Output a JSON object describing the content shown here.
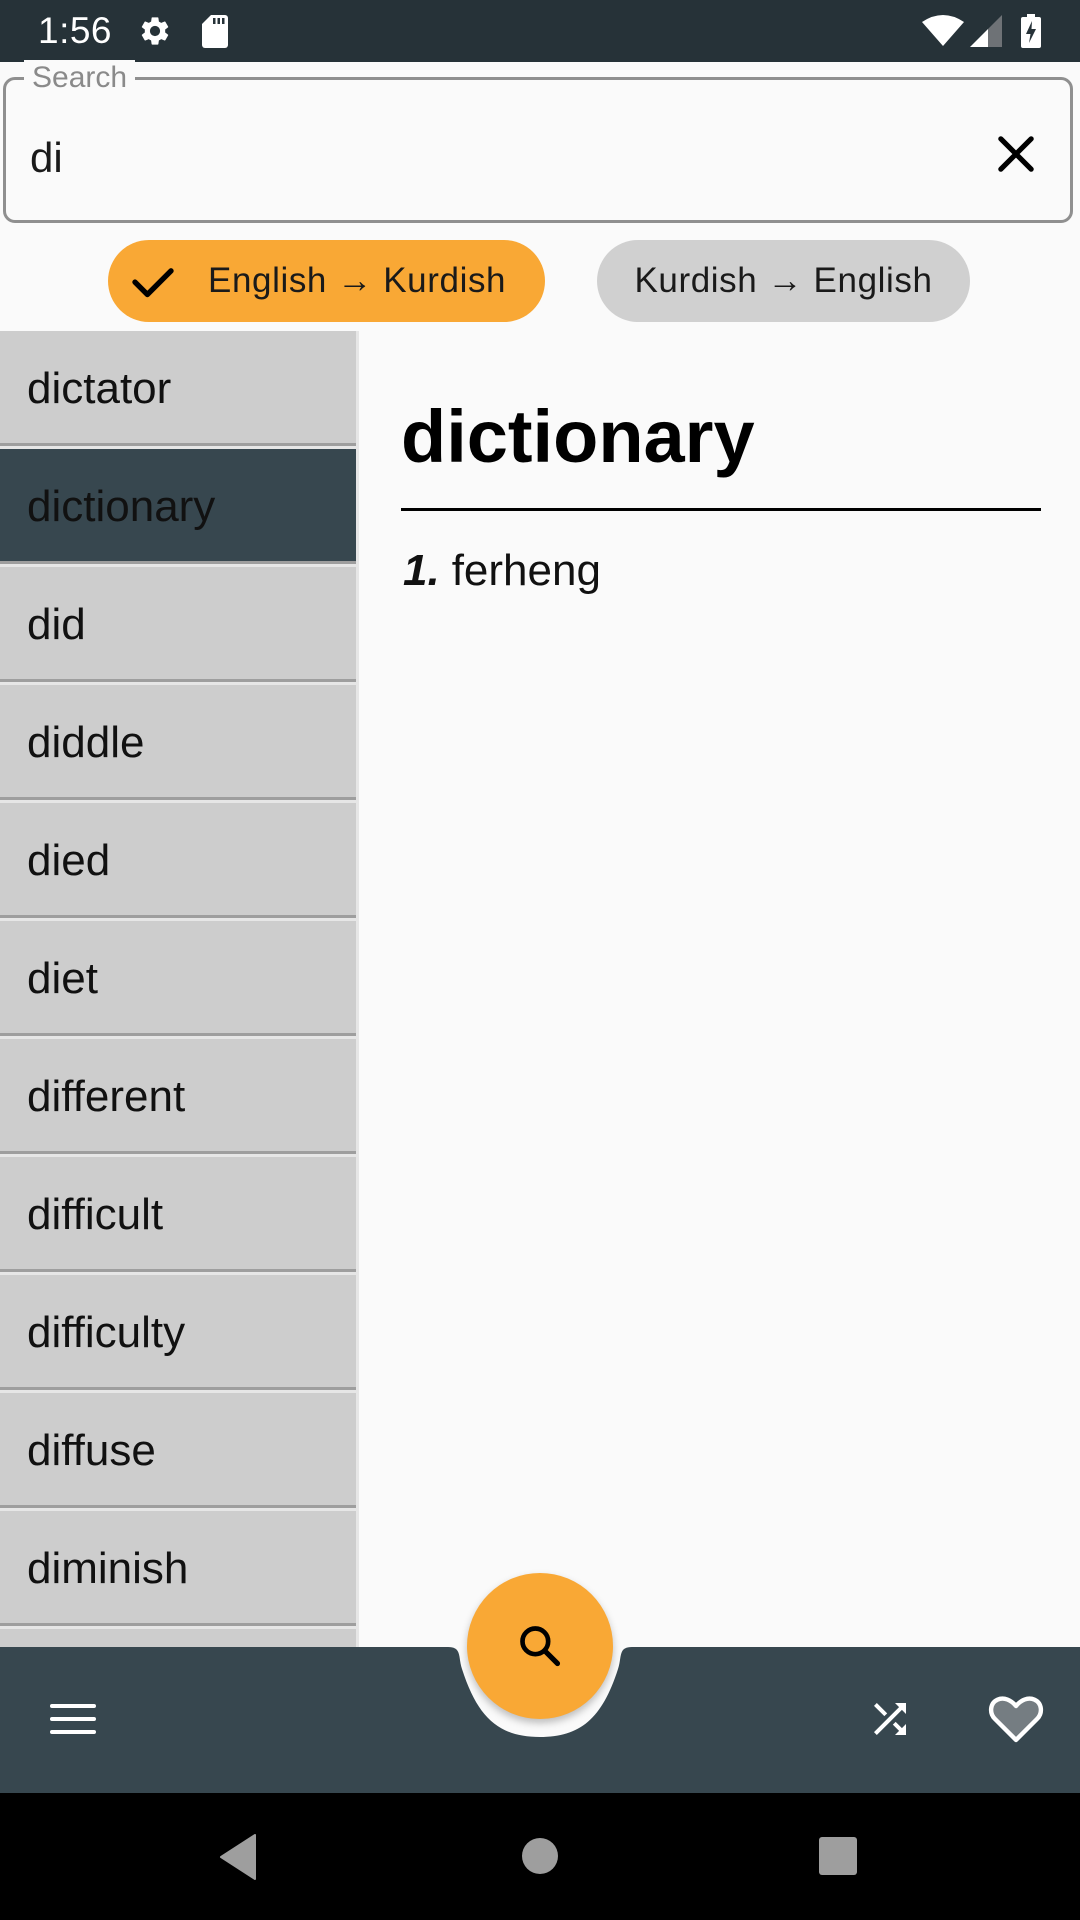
{
  "status_bar": {
    "time": "1:56",
    "icons": [
      "settings-icon",
      "sd-card-icon",
      "wifi-icon",
      "cell-signal-icon",
      "battery-charging-icon"
    ]
  },
  "search": {
    "label": "Search",
    "value": "di",
    "clear_icon": "close-icon"
  },
  "direction_chips": [
    {
      "label": "English → Kurdish",
      "selected": true,
      "icon": "check-icon"
    },
    {
      "label": "Kurdish → English",
      "selected": false
    }
  ],
  "word_list": {
    "selected_index": 1,
    "items": [
      "dictator",
      "dictionary",
      "did",
      "diddle",
      "died",
      "diet",
      "different",
      "difficult",
      "difficulty",
      "diffuse",
      "diminish",
      ""
    ]
  },
  "detail": {
    "headword": "dictionary",
    "definitions": [
      {
        "number": "1.",
        "text": "ferheng"
      }
    ]
  },
  "bottom_bar": {
    "menu_icon": "menu-icon",
    "fab_icon": "search-icon",
    "shuffle_icon": "shuffle-icon",
    "favorite_icon": "heart-icon"
  },
  "colors": {
    "accent": "#f9a835",
    "primary_dark": "#37474f",
    "status_bar": "#263238",
    "list_bg": "#cdcdcd",
    "chip_inactive": "#d0d0d0"
  }
}
